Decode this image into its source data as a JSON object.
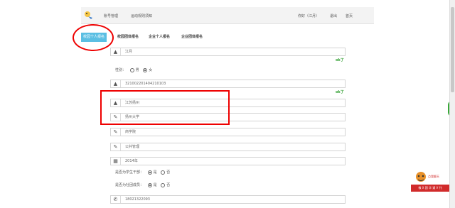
{
  "header": {
    "nav_account": "账号管理",
    "nav_notice": "运动规则须知",
    "greeting": "你好（江月）",
    "logout": "退出",
    "home": "首页"
  },
  "tabs": [
    "校园个人报名",
    "校园团体报名",
    "企业个人报名",
    "企业团体报名"
  ],
  "form": {
    "name_value": "江月",
    "ok_mark": "ok了",
    "gender_label": "性别：",
    "gender_options": [
      "男",
      "女"
    ],
    "gender_selected": "女",
    "id_value": "321002201404210103",
    "ok_mark_2": "ok了",
    "region_value": "江苏扬州",
    "school_value": "扬州大学",
    "college_value": "商学院",
    "major_value": "公共管理",
    "year_value": "2014年",
    "cadre_label": "是否为学生干部：",
    "cadre_options": [
      "是",
      "否"
    ],
    "cadre_selected": "是",
    "club_label": "是否为社团成员：",
    "club_options": [
      "是",
      "否"
    ],
    "club_selected": "是",
    "phone_value": "18021322093"
  },
  "widget": {
    "bubble": "点我聊天",
    "banner": "敬 X 国 华 通 V 刊"
  },
  "icons": {
    "person": "person-icon",
    "pencil": "pencil-icon",
    "calendar": "calendar-icon",
    "phone": "phone-icon"
  },
  "colors": {
    "tab_active": "#5bbfe3",
    "annotation_red": "#e00000",
    "ok_green": "#2e9e2e"
  }
}
